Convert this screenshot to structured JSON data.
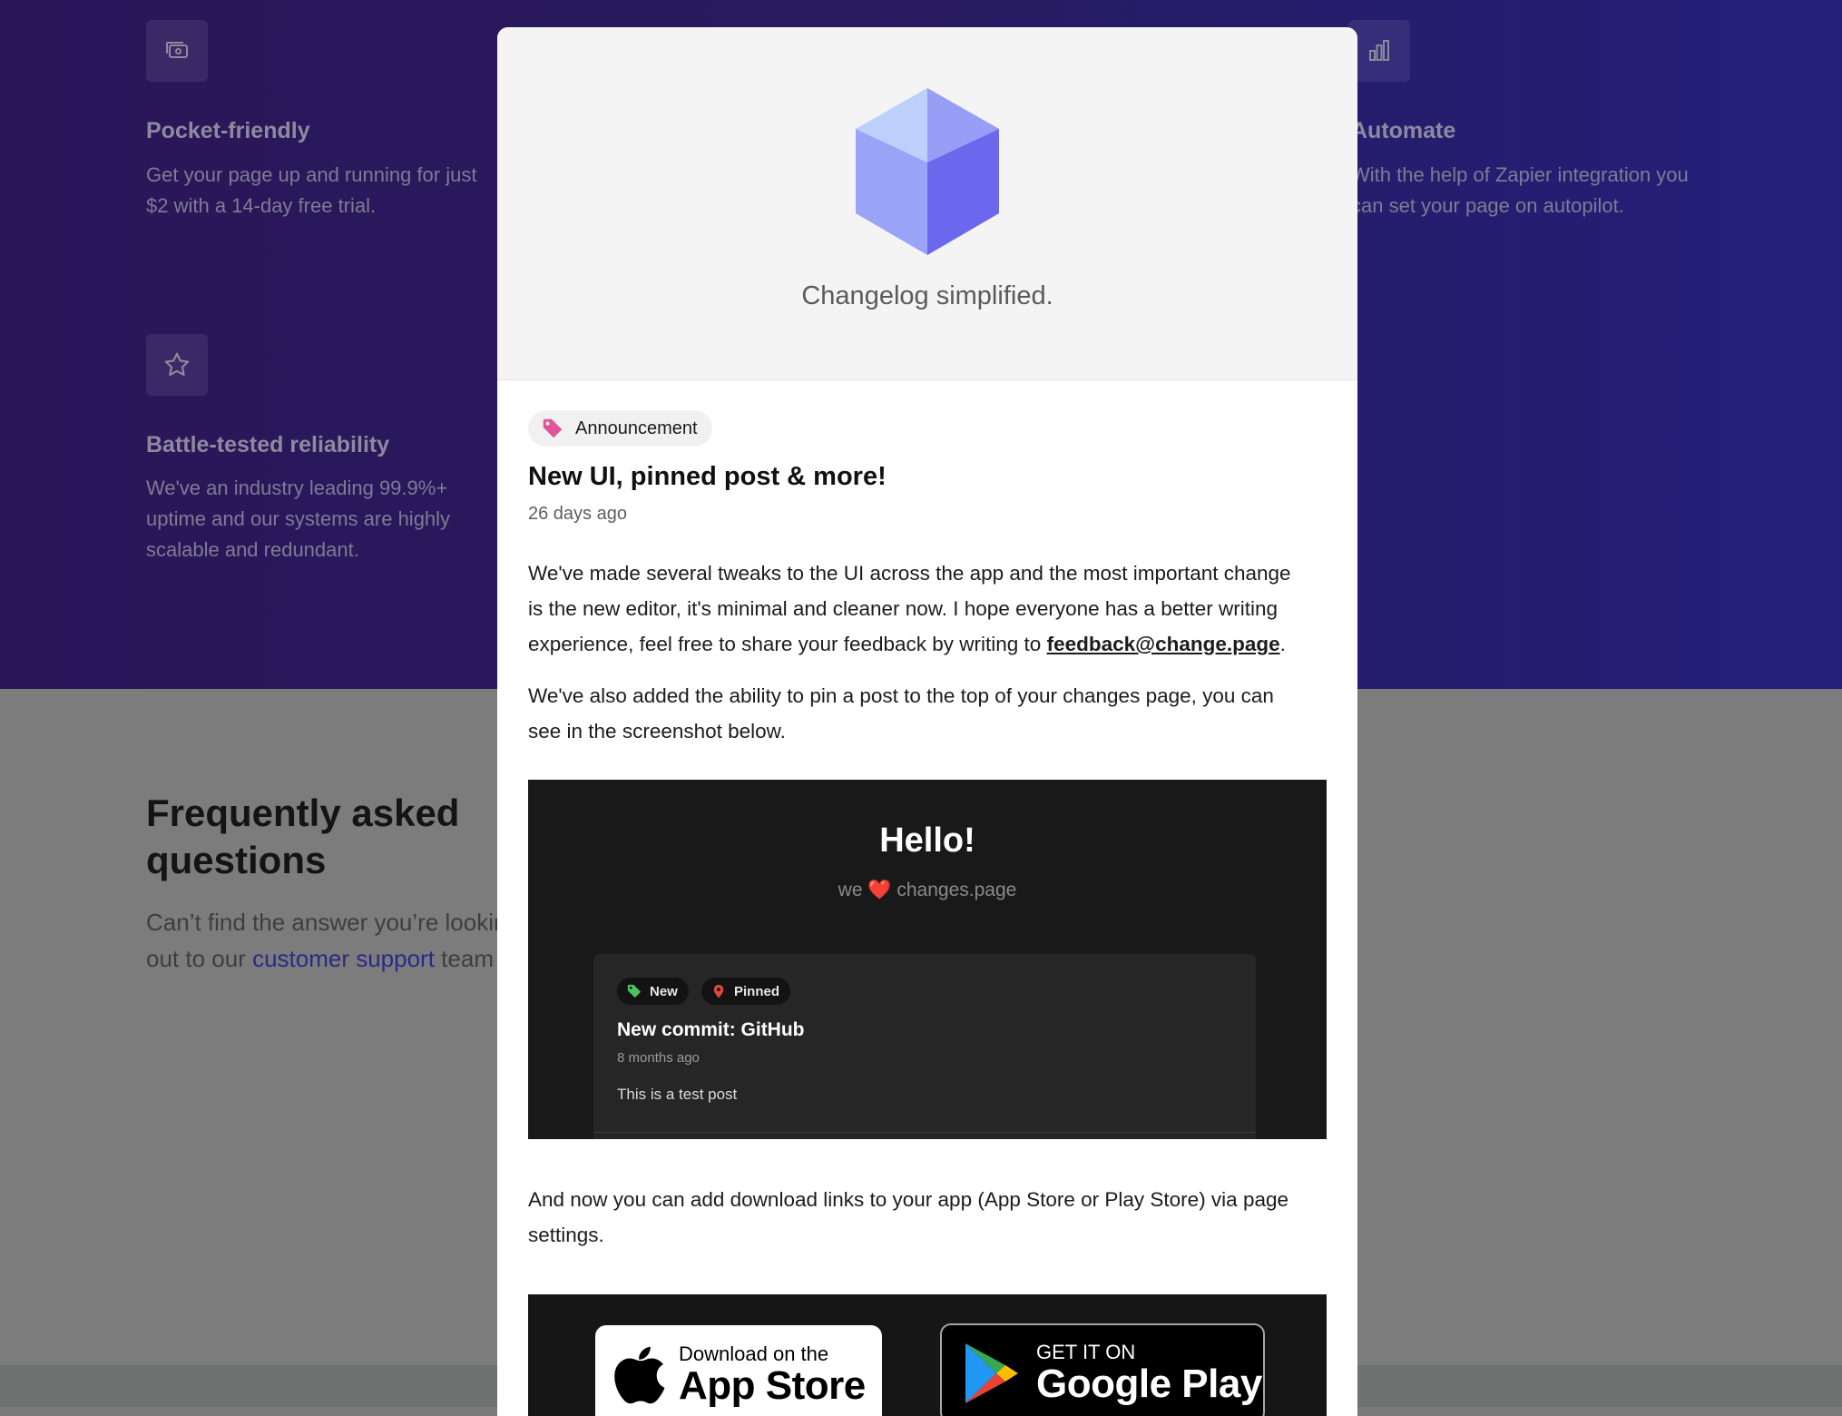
{
  "features": [
    {
      "title": "Pocket-friendly",
      "desc_line1": "Get your page up and running for just",
      "desc_line2": "$2 with a 14-day free trial.",
      "icon": "money-icon"
    },
    {
      "title": "Automate",
      "desc_line1": "With the help of Zapier integration you",
      "desc_line2": "can set your page on autopilot.",
      "icon": "bar-chart-icon"
    },
    {
      "title": "Battle-tested reliability",
      "desc_line1": "We've an industry leading 99.9%+",
      "desc_line2": "uptime and our systems are highly",
      "desc_line3": "scalable and redundant.",
      "icon": "star-icon"
    }
  ],
  "faq": {
    "title_line1": "Frequently asked",
    "title_line2": "questions",
    "desc_line1": "Can’t find the answer you’re lookir",
    "desc_pre": "out to our ",
    "desc_link": "customer support",
    "desc_post": " team"
  },
  "modal": {
    "tagline": "Changelog simplified.",
    "badge": "Announcement",
    "post_title": "New UI, pinned post & more!",
    "post_date": "26 days ago",
    "para1_line1": "We've made several tweaks to the UI across the app and the most important change",
    "para1_line2": "is the new editor, it's minimal and cleaner now. I hope everyone has a better writing",
    "para1_line3_pre": "experience, feel free to share your feedback by writing to ",
    "para1_link": "feedback@change.page",
    "para1_line3_post": ".",
    "para2_line1": "We've also added the ability to pin a post to the top of your changes page, you can",
    "para2_line2": "see in the screenshot below.",
    "para3_line1": "And now you can add download links to your app (App Store or Play Store) via page",
    "para3_line2": "settings."
  },
  "screenshot": {
    "hello": "Hello!",
    "sub_pre": "we",
    "sub_heart": "❤️",
    "sub_post": "changes.page",
    "pill_new": "New",
    "pill_pinned": "Pinned",
    "card_title": "New commit: GitHub",
    "card_date": "8 months ago",
    "card_body": "This is a test post"
  },
  "stores": {
    "apple_small": "Download on the",
    "apple_big": "App Store",
    "google_small": "GET IT ON",
    "google_big": "Google Play"
  },
  "colors": {
    "badge_tag": "#e0559a",
    "pill_new_tag": "#4fc35a",
    "pill_pinned": "#e04a3d",
    "logo_left": "#9aa4f6",
    "logo_right": "#6b68ee",
    "logo_top": "#bcd0fb"
  }
}
